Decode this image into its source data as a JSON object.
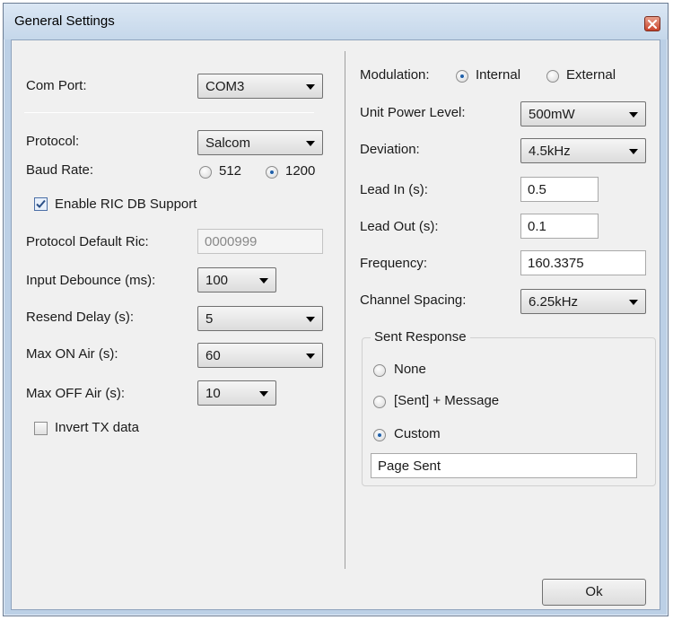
{
  "window": {
    "title": "General Settings"
  },
  "left": {
    "com_port": {
      "label": "Com Port:",
      "value": "COM3"
    },
    "protocol": {
      "label": "Protocol:",
      "value": "Salcom"
    },
    "baud_rate": {
      "label": "Baud Rate:",
      "options": [
        "512",
        "1200"
      ],
      "selected": "1200"
    },
    "enable_ric_db": {
      "label": "Enable RIC DB Support",
      "checked": true
    },
    "protocol_default_ric": {
      "label": "Protocol Default Ric:",
      "value": "0000999"
    },
    "input_debounce": {
      "label": "Input Debounce (ms):",
      "value": "100"
    },
    "resend_delay": {
      "label": "Resend Delay (s):",
      "value": "5"
    },
    "max_on_air": {
      "label": "Max ON Air (s):",
      "value": "60"
    },
    "max_off_air": {
      "label": "Max OFF Air (s):",
      "value": "10"
    },
    "invert_tx": {
      "label": "Invert TX data",
      "checked": false
    }
  },
  "right": {
    "modulation": {
      "label": "Modulation:",
      "options": [
        "Internal",
        "External"
      ],
      "selected": "Internal"
    },
    "unit_power_level": {
      "label": "Unit Power Level:",
      "value": "500mW"
    },
    "deviation": {
      "label": "Deviation:",
      "value": "4.5kHz"
    },
    "lead_in": {
      "label": "Lead In (s):",
      "value": "0.5"
    },
    "lead_out": {
      "label": "Lead Out (s):",
      "value": "0.1"
    },
    "frequency": {
      "label": "Frequency:",
      "value": "160.3375"
    },
    "channel_spacing": {
      "label": "Channel Spacing:",
      "value": "6.25kHz"
    },
    "sent_response": {
      "title": "Sent Response",
      "options": [
        "None",
        "[Sent] + Message",
        "Custom"
      ],
      "selected": "Custom",
      "custom_text": "Page Sent"
    }
  },
  "buttons": {
    "ok": "Ok"
  },
  "colors": {
    "titlebar": "#c5d7ea",
    "client_bg": "#f0f0f0",
    "radio_dot": "#1f5fa8",
    "close_button": "#c9432b"
  }
}
